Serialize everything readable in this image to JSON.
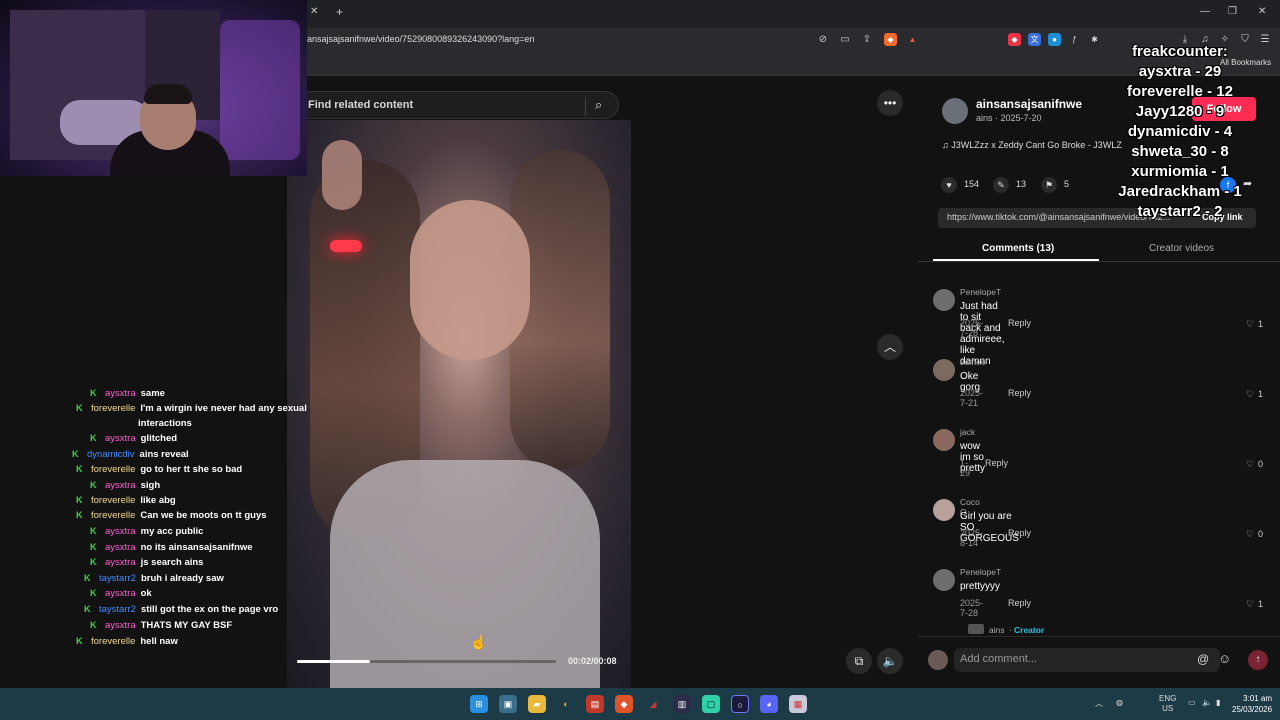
{
  "browser": {
    "url": "ansajsajsanifnwe/video/7529080089326243090?lang=en",
    "bookmarks_label": "All Bookmarks",
    "new_tab_symbol": "+",
    "close_tab_symbol": "✕"
  },
  "page": {
    "search_placeholder": "Find related content",
    "video_time": "00:02/00:08",
    "video_progress_fraction": 0.28
  },
  "post": {
    "author_handle": "ainsansajsanifnwe",
    "author_sub": "ains · 2025-7-20",
    "follow_label": "Follow",
    "music": "J3WLZzz x Zeddy Cant Go Broke - J3WLZ",
    "likes": "154",
    "comments_count": "13",
    "saves": "5",
    "link": "https://www.tiktok.com/@ainsansajsanifnwe/video/752...",
    "copy_link": "Copy link",
    "tab_comments": "Comments (13)",
    "tab_creator": "Creator videos",
    "add_comment_placeholder": "Add comment...",
    "creator_reply_name": "ains",
    "creator_reply_tag": "Creator"
  },
  "comments": [
    {
      "name": "PenelopeT",
      "text": "Just had to sit back and admireee, like damnn",
      "date": "2025-7-28",
      "reply": "Reply",
      "likes": "1",
      "avatar_color": "#6d6d6d"
    },
    {
      "name": "Jamee",
      "text": "Oke gorg",
      "date": "2025-7-21",
      "reply": "Reply",
      "likes": "1",
      "avatar_color": "#7c6a5e"
    },
    {
      "name": "jack",
      "text": "wow im so pretty",
      "date": "1-29",
      "reply": "Reply",
      "likes": "0",
      "avatar_color": "#8a6a60"
    },
    {
      "name": "Coco O",
      "text": "Girl you are SO GORGEOUS",
      "date": "2025-8-14",
      "reply": "Reply",
      "likes": "0",
      "avatar_color": "#b9a29c"
    },
    {
      "name": "PenelopeT",
      "text": "prettyyyy",
      "date": "2025-7-28",
      "reply": "Reply",
      "likes": "1",
      "avatar_color": "#6d6d6d"
    }
  ],
  "chat": [
    {
      "user": "aysxtra",
      "color": "#ff5fd2",
      "msg": "same"
    },
    {
      "user": "foreverelle",
      "color": "#f2d98a",
      "msg": "I'm a wirgin ive never had any sexual"
    },
    {
      "user": "",
      "color": "#fff",
      "msg": "interactions"
    },
    {
      "user": "aysxtra",
      "color": "#ff5fd2",
      "msg": "glitched"
    },
    {
      "user": "dynamicdiv",
      "color": "#3f8cff",
      "msg": "ains reveal"
    },
    {
      "user": "foreverelle",
      "color": "#f2d98a",
      "msg": "go to her tt she so bad"
    },
    {
      "user": "aysxtra",
      "color": "#ff5fd2",
      "msg": "sigh"
    },
    {
      "user": "foreverelle",
      "color": "#f2d98a",
      "msg": "like abg"
    },
    {
      "user": "foreverelle",
      "color": "#f2d98a",
      "msg": "Can we be moots on tt guys"
    },
    {
      "user": "aysxtra",
      "color": "#ff5fd2",
      "msg": "my acc public"
    },
    {
      "user": "aysxtra",
      "color": "#ff5fd2",
      "msg": "no its ainsansajsanifnwe"
    },
    {
      "user": "aysxtra",
      "color": "#ff5fd2",
      "msg": "js search ains"
    },
    {
      "user": "taystarr2",
      "color": "#3f8cff",
      "msg": "bruh i already saw"
    },
    {
      "user": "aysxtra",
      "color": "#ff5fd2",
      "msg": "ok"
    },
    {
      "user": "taystarr2",
      "color": "#3f8cff",
      "msg": "still got the ex on the page vro"
    },
    {
      "user": "aysxtra",
      "color": "#ff5fd2",
      "msg": "THATS MY GAY BSF"
    },
    {
      "user": "foreverelle",
      "color": "#f2d98a",
      "msg": "hell naw"
    }
  ],
  "freak_counter": [
    "freakcounter:",
    "aysxtra - 29",
    "foreverelle - 12",
    "Jayy1280 - 9",
    "dynamicdiv - 4",
    "shweta_30 - 8",
    "xurmiomia - 1",
    "Jaredrackham - 1",
    "taystarr2 - 2"
  ],
  "taskbar": {
    "lang_top": "ENG",
    "lang_bottom": "US",
    "time": "3:01 am",
    "date": "25/03/2026"
  }
}
